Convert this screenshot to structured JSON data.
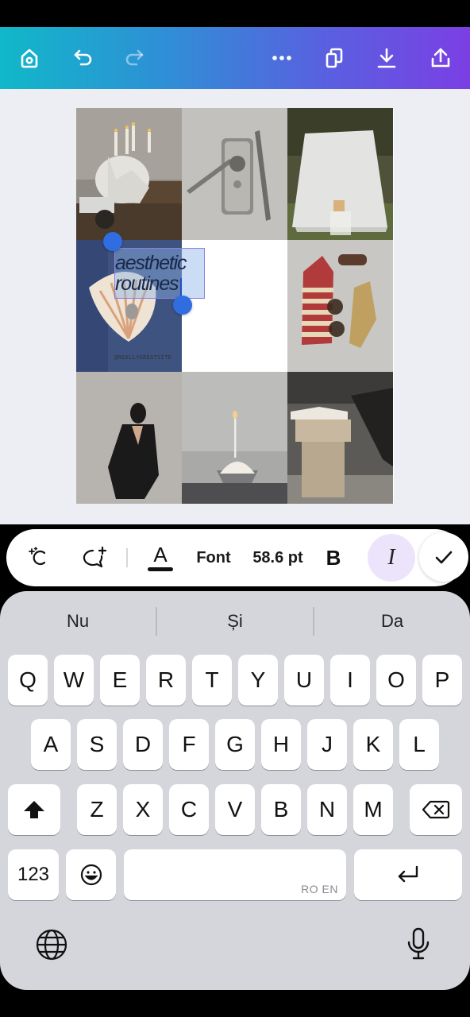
{
  "toolbar": {
    "home_icon": "home-icon",
    "undo_icon": "undo-icon",
    "redo_icon": "redo-icon",
    "more_icon": "more-icon",
    "pages_icon": "pages-icon",
    "download_icon": "download-icon",
    "share_icon": "share-icon"
  },
  "design": {
    "headline_line1": "aesthetic",
    "headline_line2": "routines",
    "site": "@REALLYGREATSITE"
  },
  "format_bar": {
    "magic_icon": "magic-write-icon",
    "comment_icon": "add-comment-icon",
    "text_color_label": "A",
    "text_color_hex": "#111111",
    "font_label": "Font",
    "font_size": "58.6 pt",
    "bold_label": "B",
    "italic_label": "I",
    "done_icon": "checkmark-icon"
  },
  "keyboard": {
    "suggestions": [
      "Nu",
      "Și",
      "Da"
    ],
    "row1": [
      "Q",
      "W",
      "E",
      "R",
      "T",
      "Y",
      "U",
      "I",
      "O",
      "P"
    ],
    "row2": [
      "A",
      "S",
      "D",
      "F",
      "G",
      "H",
      "J",
      "K",
      "L"
    ],
    "row3": [
      "Z",
      "X",
      "C",
      "V",
      "B",
      "N",
      "M"
    ],
    "numbers_label": "123",
    "space_lang": "RO EN"
  }
}
